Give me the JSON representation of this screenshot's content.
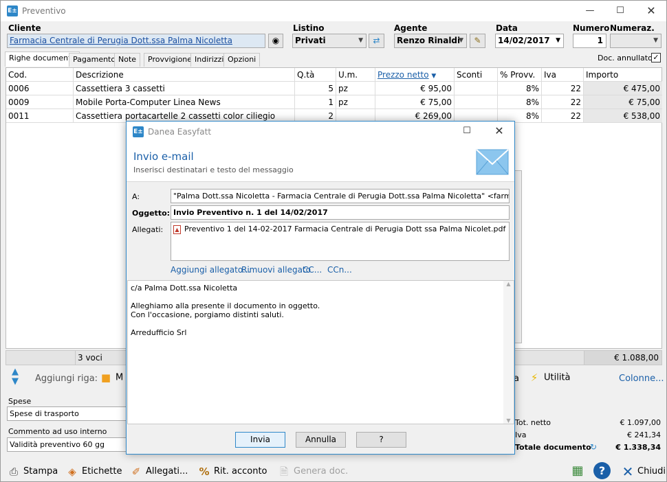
{
  "window": {
    "title": "Preventivo",
    "icon": "E±"
  },
  "header": {
    "cliente_label": "Cliente",
    "cliente_value": "Farmacia Centrale di Perugia Dott.ssa Palma Nicoletta",
    "listino_label": "Listino",
    "listino_value": "Privati",
    "agente_label": "Agente",
    "agente_value": "Renzo Rinaldi",
    "data_label": "Data",
    "data_value": "14/02/2017",
    "numero_label": "Numero",
    "numero_value": "1",
    "numeraz_label": "Numeraz.",
    "numeraz_value": ""
  },
  "tabs": [
    "Righe documento",
    "Pagamento",
    "Note",
    "Provvigione",
    "Indirizzi",
    "Opzioni"
  ],
  "doc_annullato_label": "Doc. annullato",
  "grid": {
    "headers": [
      "Cod.",
      "Descrizione",
      "Q.tà",
      "U.m.",
      "Prezzo netto",
      "Sconti",
      "% Provv.",
      "Iva",
      "Importo"
    ],
    "rows": [
      [
        "0006",
        "Cassettiera 3 cassetti",
        "5",
        "pz",
        "€ 95,00",
        "",
        "8%",
        "22",
        "€ 475,00"
      ],
      [
        "0009",
        "Mobile Porta-Computer Linea News",
        "1",
        "pz",
        "€ 75,00",
        "",
        "8%",
        "22",
        "€ 75,00"
      ],
      [
        "0011",
        "Cassettiera portacartelle 2 cassetti color ciliegio",
        "2",
        "",
        "€ 269,00",
        "",
        "8%",
        "22",
        "€ 538,00"
      ]
    ],
    "footer_count": "3 voci",
    "footer_total": "€ 1.088,00"
  },
  "addrow": {
    "label": "Aggiungi riga:",
    "first_item": "M",
    "partial_item": "a",
    "utilita": "Utilità",
    "colonne": "Colonne..."
  },
  "spese": {
    "label": "Spese",
    "value": "Spese di trasporto"
  },
  "commento": {
    "label": "Commento ad uso interno",
    "value": "Validità preventivo 60 gg"
  },
  "totals": [
    {
      "label": "Tot. netto",
      "value": "€ 1.097,00"
    },
    {
      "label": "Iva",
      "value": "€ 241,34"
    },
    {
      "label": "Totale documento",
      "value": "€ 1.338,34"
    }
  ],
  "toolbar": {
    "stampa": "Stampa",
    "etichette": "Etichette",
    "allegati": "Allegati...",
    "rit_acconto": "Rit. acconto",
    "genera": "Genera doc.",
    "chiudi": "Chiudi"
  },
  "dialog": {
    "title": "Danea Easyfatt",
    "heading": "Invio e-mail",
    "subheading": "Inserisci destinatari e testo del messaggio",
    "a_label": "A:",
    "a_value": "\"Palma Dott.ssa Nicoletta - Farmacia Centrale di Perugia Dott.ssa Palma Nicoletta\" <farmaciadiperugia",
    "oggetto_label": "Oggetto:",
    "oggetto_value": "Invio Preventivo n. 1 del 14/02/2017",
    "allegati_label": "Allegati:",
    "attachment": "Preventivo 1 del 14-02-2017  Farmacia Centrale di Perugia Dott ssa Palma Nicolet.pdf",
    "links": [
      "Aggiungi allegato...",
      "Rimuovi allegato",
      "CC...",
      "CCn..."
    ],
    "body_lines": [
      "c/a Palma Dott.ssa Nicoletta",
      "",
      "Alleghiamo alla presente il documento in oggetto.",
      "Con l'occasione, porgiamo distinti saluti.",
      "",
      "Arredufficio Srl"
    ],
    "buttons": {
      "invia": "Invia",
      "annulla": "Annulla",
      "help": "?"
    }
  },
  "colors": {
    "accent": "#2e87c8",
    "link": "#1a5fa8"
  }
}
